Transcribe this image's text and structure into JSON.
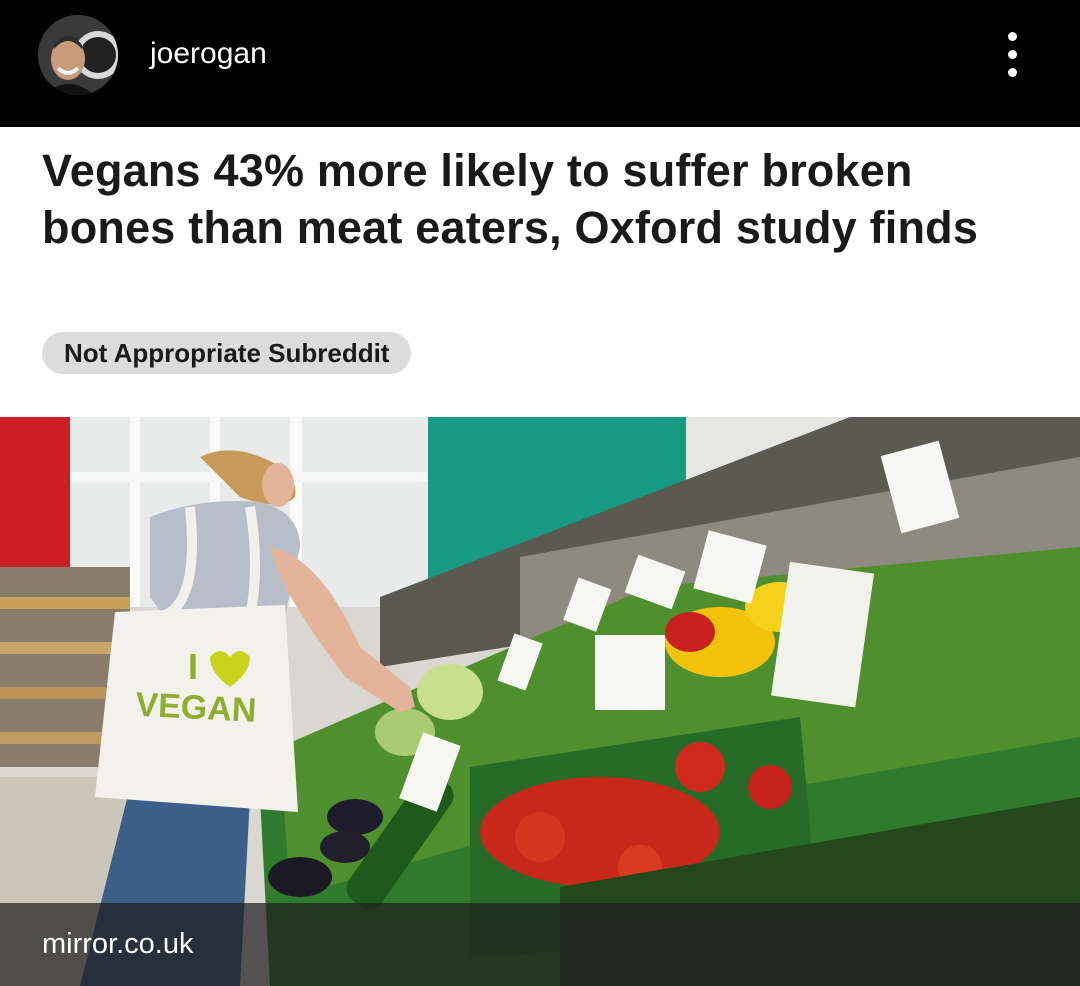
{
  "post": {
    "username": "joerogan",
    "avatar_icon": "profile-avatar",
    "menu_icon": "more-vertical-icon"
  },
  "link_card": {
    "headline": "Vegans 43% more likely to suffer broken bones than meat eaters, Oxford study finds",
    "flair": "Not Appropriate Subreddit",
    "image_bag_text_top": "I",
    "image_bag_text_bottom": "VEGAN",
    "source_domain": "mirror.co.uk"
  }
}
